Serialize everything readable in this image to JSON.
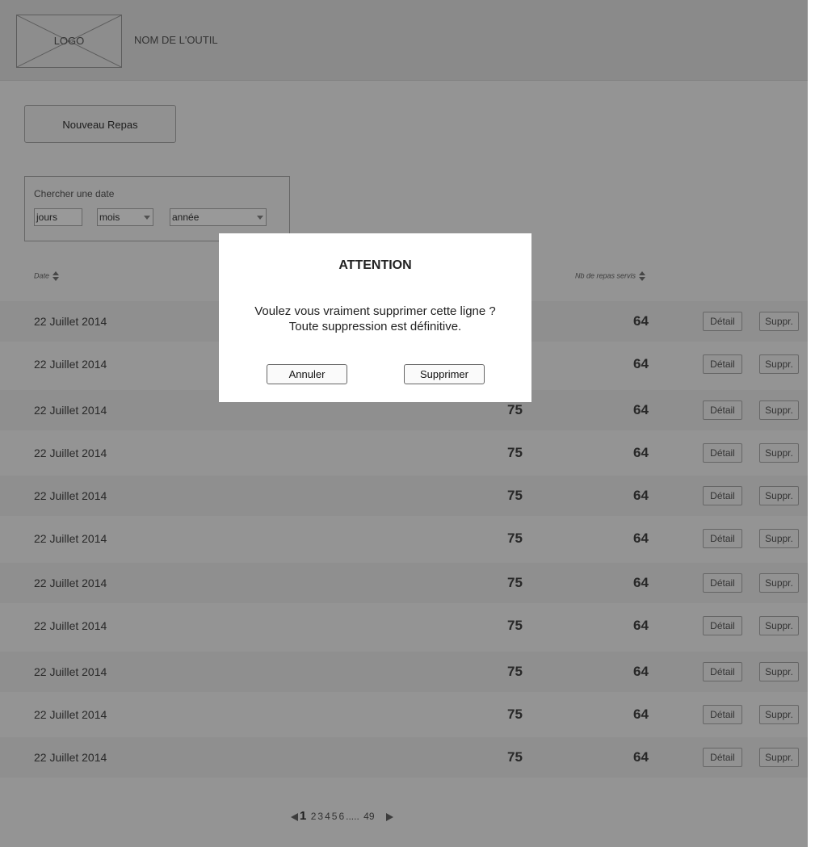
{
  "header": {
    "logo_text": "LOGO",
    "tool_name": "NOM DE L'OUTIL"
  },
  "new_meal_button": "Nouveau Repas",
  "search": {
    "title": "Chercher une date",
    "day_placeholder": "jours",
    "month_value": "mois",
    "year_value": "année"
  },
  "table": {
    "headers": {
      "date": "Date",
      "served": "Nb de repas servis"
    },
    "rows": [
      {
        "date": "22 Juillet 2014",
        "a": "",
        "b": "64",
        "detail": "Détail",
        "delete": "Suppr."
      },
      {
        "date": "22 Juillet 2014",
        "a": "",
        "b": "64",
        "detail": "Détail",
        "delete": "Suppr."
      },
      {
        "date": "22 Juillet 2014",
        "a": "75",
        "b": "64",
        "detail": "Détail",
        "delete": "Suppr."
      },
      {
        "date": "22 Juillet 2014",
        "a": "75",
        "b": "64",
        "detail": "Détail",
        "delete": "Suppr."
      },
      {
        "date": "22 Juillet 2014",
        "a": "75",
        "b": "64",
        "detail": "Détail",
        "delete": "Suppr."
      },
      {
        "date": "22 Juillet 2014",
        "a": "75",
        "b": "64",
        "detail": "Détail",
        "delete": "Suppr."
      },
      {
        "date": "22 Juillet 2014",
        "a": "75",
        "b": "64",
        "detail": "Détail",
        "delete": "Suppr."
      },
      {
        "date": "22 Juillet 2014",
        "a": "75",
        "b": "64",
        "detail": "Détail",
        "delete": "Suppr."
      },
      {
        "date": "22 Juillet 2014",
        "a": "75",
        "b": "64",
        "detail": "Détail",
        "delete": "Suppr."
      },
      {
        "date": "22 Juillet 2014",
        "a": "75",
        "b": "64",
        "detail": "Détail",
        "delete": "Suppr."
      },
      {
        "date": "22 Juillet 2014",
        "a": "75",
        "b": "64",
        "detail": "Détail",
        "delete": "Suppr."
      }
    ]
  },
  "pagination": {
    "current": "1",
    "pages": [
      "2",
      "3",
      "4",
      "5",
      "6"
    ],
    "ellipsis": ".....",
    "last": "49"
  },
  "modal": {
    "title": "ATTENTION",
    "message_line1": "Voulez vous vraiment supprimer cette ligne ?",
    "message_line2": "Toute suppression est définitive.",
    "cancel_label": "Annuler",
    "confirm_label": "Supprimer"
  }
}
